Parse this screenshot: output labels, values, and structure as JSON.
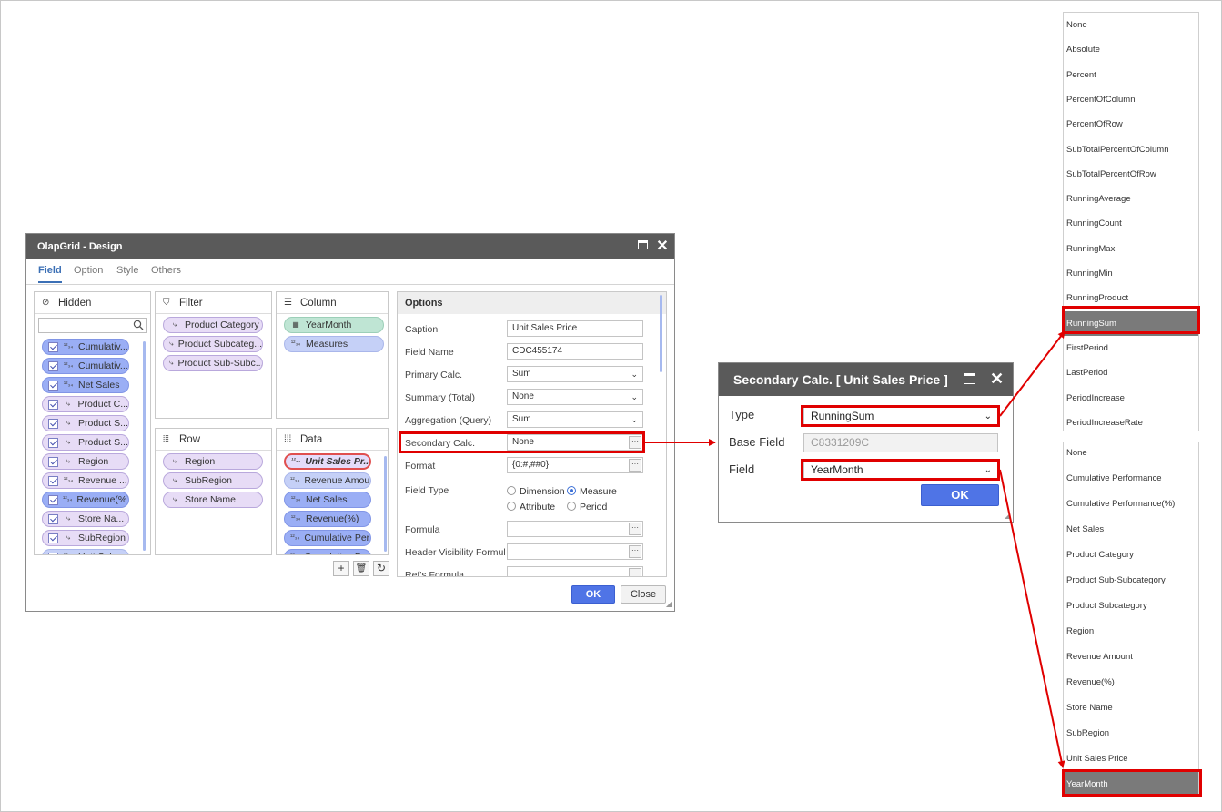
{
  "olap_dialog": {
    "title": "OlapGrid - Design",
    "tabs": [
      "Field",
      "Option",
      "Style",
      "Others"
    ],
    "panels": {
      "hidden": "Hidden",
      "filter": "Filter",
      "column": "Column",
      "row": "Row",
      "data": "Data",
      "options": "Options"
    },
    "hidden_items": [
      {
        "label": "Cumulativ...",
        "style": "blue",
        "icon": "measure-icon"
      },
      {
        "label": "Cumulativ...",
        "style": "blue",
        "icon": "measure-icon"
      },
      {
        "label": "Net Sales",
        "style": "blue",
        "icon": "measure-icon"
      },
      {
        "label": "Product C...",
        "style": "purple",
        "icon": "dimension-icon"
      },
      {
        "label": "Product S...",
        "style": "purple",
        "icon": "dimension-icon"
      },
      {
        "label": "Product S...",
        "style": "purple",
        "icon": "dimension-icon"
      },
      {
        "label": "Region",
        "style": "purple",
        "icon": "dimension-icon"
      },
      {
        "label": "Revenue ...",
        "style": "purple",
        "icon": "measure-icon"
      },
      {
        "label": "Revenue(%)",
        "style": "blue",
        "icon": "measure-icon"
      },
      {
        "label": "Store Na...",
        "style": "purple",
        "icon": "dimension-icon"
      },
      {
        "label": "SubRegion",
        "style": "purple",
        "icon": "dimension-icon"
      },
      {
        "label": "Unit Sales",
        "style": "lblue",
        "icon": "measure-icon"
      }
    ],
    "filter_items": [
      "Product Category",
      "Product Subcateg...",
      "Product Sub-Subc..."
    ],
    "column_items": [
      {
        "label": "YearMonth",
        "style": "green",
        "icon": "calendar-icon"
      },
      {
        "label": "Measures",
        "style": "lblue",
        "icon": "measure-icon"
      }
    ],
    "row_items": [
      "Region",
      "SubRegion",
      "Store Name"
    ],
    "data_items": [
      {
        "label": "Unit Sales Pr...",
        "style": "selected"
      },
      {
        "label": "Revenue Amou...",
        "style": "lblue"
      },
      {
        "label": "Net Sales",
        "style": "blue"
      },
      {
        "label": "Revenue(%)",
        "style": "blue"
      },
      {
        "label": "Cumulative Per...",
        "style": "blue"
      },
      {
        "label": "Cumulative Per...",
        "style": "blue"
      }
    ],
    "options": {
      "caption_label": "Caption",
      "caption_value": "Unit Sales Price",
      "fieldname_label": "Field Name",
      "fieldname_value": "CDC455174",
      "primary_label": "Primary Calc.",
      "primary_value": "Sum",
      "summary_label": "Summary (Total)",
      "summary_value": "None",
      "aggregation_label": "Aggregation (Query)",
      "aggregation_value": "Sum",
      "secondary_label": "Secondary Calc.",
      "secondary_value": "None",
      "format_label": "Format",
      "format_value": "{0:#,##0}",
      "fieldtype_label": "Field Type",
      "fieldtype_options": [
        "Dimension",
        "Measure",
        "Attribute",
        "Period"
      ],
      "fieldtype_selected": "Measure",
      "formula_label": "Formula",
      "header_vis_label": "Header Visibility Formula",
      "ref_label": "Ref's Formula"
    },
    "ok_label": "OK",
    "close_label": "Close"
  },
  "secondary_dialog": {
    "title": "Secondary Calc. [ Unit Sales Price ]",
    "type_label": "Type",
    "type_value": "RunningSum",
    "base_label": "Base Field",
    "base_value": "C8331209C",
    "field_label": "Field",
    "field_value": "YearMonth",
    "ok_label": "OK"
  },
  "type_list": {
    "items": [
      "None",
      "Absolute",
      "Percent",
      "PercentOfColumn",
      "PercentOfRow",
      "SubTotalPercentOfColumn",
      "SubTotalPercentOfRow",
      "RunningAverage",
      "RunningCount",
      "RunningMax",
      "RunningMin",
      "RunningProduct",
      "RunningSum",
      "FirstPeriod",
      "LastPeriod",
      "PeriodIncrease",
      "PeriodIncreaseRate"
    ],
    "selected": "RunningSum"
  },
  "field_list": {
    "items": [
      "None",
      "Cumulative Performance",
      "Cumulative Performance(%)",
      "Net Sales",
      "Product Category",
      "Product Sub-Subcategory",
      "Product Subcategory",
      "Region",
      "Revenue Amount",
      "Revenue(%)",
      "Store Name",
      "SubRegion",
      "Unit Sales Price",
      "YearMonth"
    ],
    "selected": "YearMonth"
  },
  "colors": {
    "title_bar": "#5a5a5a",
    "accent_blue": "#4f74e6",
    "highlight_red": "#e00000",
    "selected_gray": "#7a7a7a"
  }
}
